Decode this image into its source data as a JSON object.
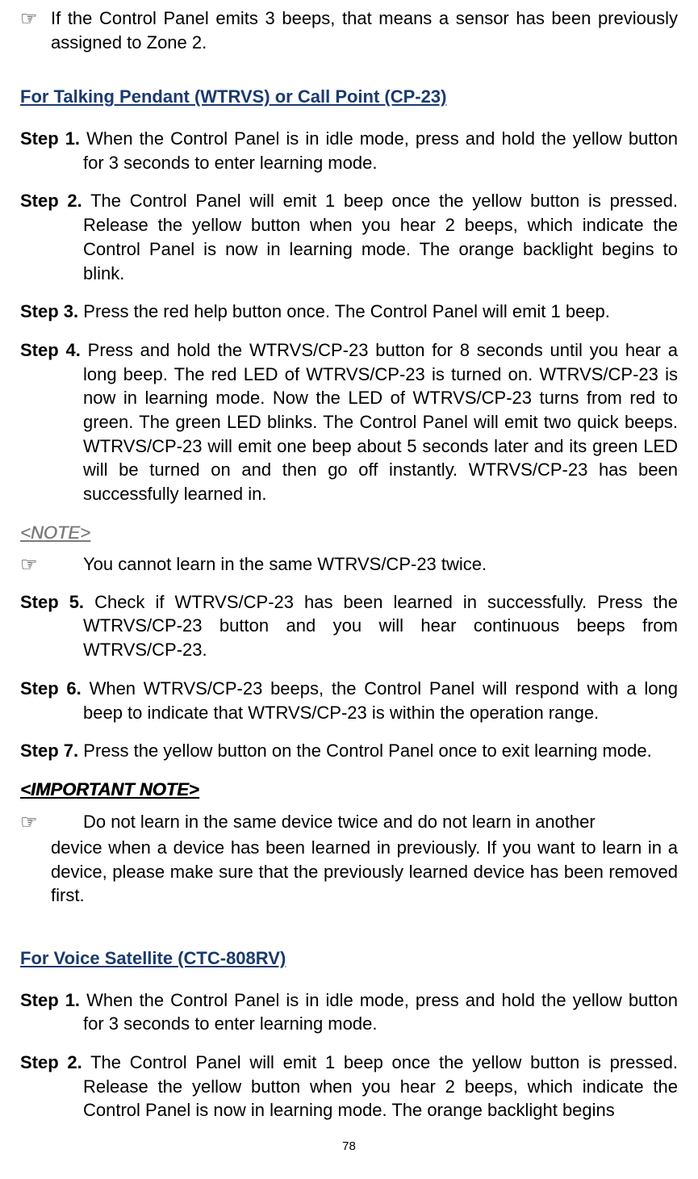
{
  "topBullet": {
    "icon": "☞",
    "text": "If the Control Panel emits 3 beeps, that means a sensor has been previously assigned to Zone 2."
  },
  "section1": {
    "heading": "For Talking Pendant (WTRVS) or Call Point (CP-23)",
    "steps": [
      {
        "label": "Step 1.",
        "text": "When the Control Panel is in idle mode, press and hold the yellow button for 3 seconds to enter learning mode."
      },
      {
        "label": "Step 2.",
        "text": "The Control Panel will emit 1 beep once the yellow button is pressed. Release the yellow button when you hear 2 beeps, which indicate the Control Panel is now in learning mode. The orange backlight begins to blink."
      },
      {
        "label": "Step 3.",
        "text": "Press the red help button once. The Control Panel will emit 1 beep."
      },
      {
        "label": "Step 4.",
        "text": "Press and hold the WTRVS/CP-23 button for 8 seconds until you hear a long beep. The red LED of WTRVS/CP-23 is turned on. WTRVS/CP-23 is now in learning mode. Now the LED of WTRVS/CP-23 turns from red to green. The green LED blinks. The Control Panel will emit two quick beeps. WTRVS/CP-23 will emit one beep about 5 seconds later and its green LED will be turned on and then go off instantly. WTRVS/CP-23 has been successfully learned in."
      }
    ],
    "note": {
      "heading": "<NOTE>",
      "icon": "☞",
      "text": "You cannot learn in the same WTRVS/CP-23 twice."
    },
    "steps2": [
      {
        "label": "Step 5.",
        "text": "Check if WTRVS/CP-23 has been learned in successfully. Press the WTRVS/CP-23 button and you will hear continuous beeps from WTRVS/CP-23."
      },
      {
        "label": "Step 6.",
        "text": "When WTRVS/CP-23 beeps, the Control Panel will respond with a long beep to indicate that WTRVS/CP-23 is within the operation range."
      },
      {
        "label": "Step 7.",
        "text": "Press the yellow button on the Control Panel once to exit learning mode."
      }
    ],
    "importantNote": {
      "heading": "<IMPORTANT NOTE>",
      "icon": "☞",
      "firstLine": "Do not learn in the same device twice and do not learn in another",
      "rest": "device when a device has been learned in previously. If you want to learn in a device, please make sure that the previously learned device has been removed first."
    }
  },
  "section2": {
    "heading": "For Voice Satellite (CTC-808RV)",
    "steps": [
      {
        "label": "Step 1.",
        "text": "When the Control Panel is in idle mode, press and hold the yellow button for 3 seconds to enter learning mode."
      },
      {
        "label": "Step 2.",
        "text": "The Control Panel will emit 1 beep once the yellow button is pressed. Release the yellow button when you hear 2 beeps, which indicate the Control Panel is now in learning mode. The orange backlight begins"
      }
    ]
  },
  "pageNumber": "78"
}
